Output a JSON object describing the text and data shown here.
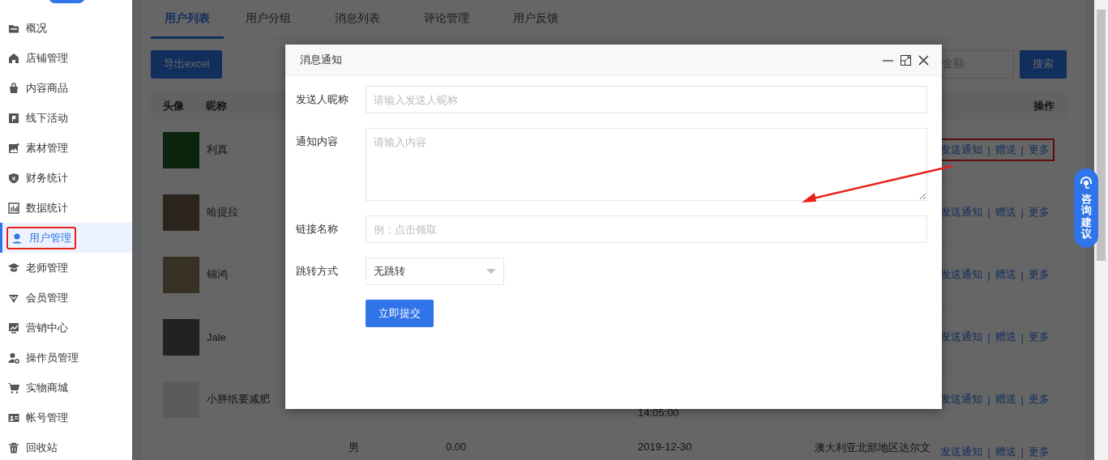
{
  "sidebar": {
    "items": [
      {
        "label": "概况",
        "selected": false,
        "annotated": false
      },
      {
        "label": "店铺管理",
        "selected": false,
        "annotated": false
      },
      {
        "label": "内容商品",
        "selected": false,
        "annotated": false
      },
      {
        "label": "线下活动",
        "selected": false,
        "annotated": false
      },
      {
        "label": "素材管理",
        "selected": false,
        "annotated": false
      },
      {
        "label": "财务统计",
        "selected": false,
        "annotated": false
      },
      {
        "label": "数据统计",
        "selected": false,
        "annotated": false
      },
      {
        "label": "用户管理",
        "selected": true,
        "annotated": true
      },
      {
        "label": "老师管理",
        "selected": false,
        "annotated": false
      },
      {
        "label": "会员管理",
        "selected": false,
        "annotated": false
      },
      {
        "label": "营销中心",
        "selected": false,
        "annotated": false
      },
      {
        "label": "操作员管理",
        "selected": false,
        "annotated": false
      },
      {
        "label": "实物商城",
        "selected": false,
        "annotated": false
      },
      {
        "label": "帐号管理",
        "selected": false,
        "annotated": false
      },
      {
        "label": "回收站",
        "selected": false,
        "annotated": false
      }
    ]
  },
  "tabs": [
    {
      "label": "用户列表",
      "selected": true
    },
    {
      "label": "用户分组",
      "selected": false
    },
    {
      "label": "消息列表",
      "selected": false
    },
    {
      "label": "评论管理",
      "selected": false
    },
    {
      "label": "用户反馈",
      "selected": false
    }
  ],
  "toolbar": {
    "export_button": "导出excel",
    "search_placeholder": "金额",
    "search_button": "搜索"
  },
  "table": {
    "columns": [
      "头像",
      "昵称",
      "操作"
    ],
    "rows": [
      {
        "nickname": "利真",
        "actions": [
          "发送通知",
          "|",
          "赠送",
          "|",
          "更多"
        ],
        "annotated": true
      },
      {
        "nickname": "哈提拉",
        "actions": [
          "发送通知",
          "|",
          "赠送",
          "|",
          "更多"
        ],
        "annotated": false
      },
      {
        "nickname": "锦鸿",
        "actions": [
          "发送通知",
          "|",
          "赠送",
          "|",
          "更多"
        ],
        "annotated": false
      },
      {
        "nickname": "Jale",
        "actions": [
          "发送通知",
          "|",
          "赠送",
          "|",
          "更多"
        ],
        "annotated": false
      },
      {
        "nickname": "小胖纸要减肥",
        "time": "14:05:00",
        "actions": [
          "发送通知",
          "|",
          "赠送",
          "|",
          "更多"
        ],
        "annotated": false
      },
      {
        "gender": "男",
        "amount": "0.00",
        "date": "2019-12-30",
        "region": "澳大利亚北部地区达尔文",
        "actions": [
          "发送通知",
          "|",
          "赠送",
          "|",
          "更多"
        ],
        "annotated": false
      }
    ]
  },
  "dialog": {
    "title": "消息通知",
    "fields": [
      {
        "kind": "input",
        "label": "发送人昵称",
        "placeholder": "请输入发送人昵称"
      },
      {
        "kind": "textarea",
        "label": "通知内容",
        "placeholder": "请输入内容"
      },
      {
        "kind": "input",
        "label": "链接名称",
        "placeholder": "例：点击领取"
      },
      {
        "kind": "select",
        "label": "跳转方式",
        "value": "无跳转"
      }
    ],
    "submit_button": "立即提交"
  },
  "consult_button": "咨询建议"
}
